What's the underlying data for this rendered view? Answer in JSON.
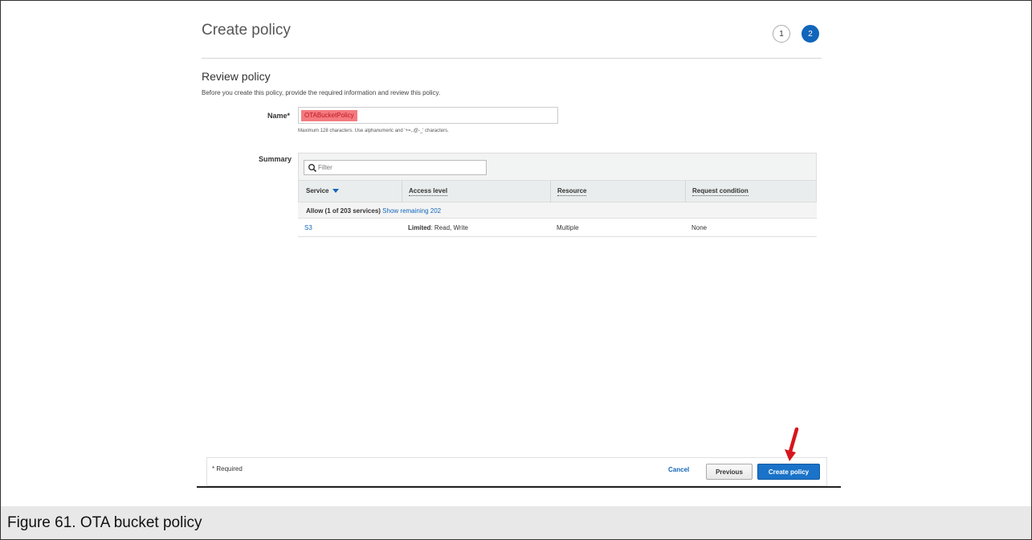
{
  "header": {
    "title": "Create policy",
    "steps": [
      "1",
      "2"
    ],
    "active_step": "2"
  },
  "review": {
    "title": "Review policy",
    "description": "Before you create this policy, provide the required information and review this policy."
  },
  "name_field": {
    "label": "Name*",
    "value": "OTABucketPolicy",
    "hint": "Maximum 128 characters. Use alphanumeric and '+=,.@-_' characters."
  },
  "summary": {
    "label": "Summary",
    "filter_placeholder": "Filter",
    "columns": [
      "Service",
      "Access level",
      "Resource",
      "Request condition"
    ],
    "group": {
      "text": "Allow (1 of 203 services)",
      "link": "Show remaining 202"
    },
    "rows": [
      {
        "service": "S3",
        "access_level_bold": "Limited",
        "access_level_rest": ": Read, Write",
        "resource": "Multiple",
        "request_condition": "None"
      }
    ]
  },
  "footer": {
    "required": "* Required",
    "cancel": "Cancel",
    "previous": "Previous",
    "create": "Create policy"
  },
  "caption": "Figure 61.  OTA bucket policy",
  "colors": {
    "accent": "#1166bb",
    "highlight": "#f47a80",
    "arrow": "#d8141c"
  },
  "icons": {
    "filter": "search-icon",
    "annotation": "red-arrow-icon"
  }
}
